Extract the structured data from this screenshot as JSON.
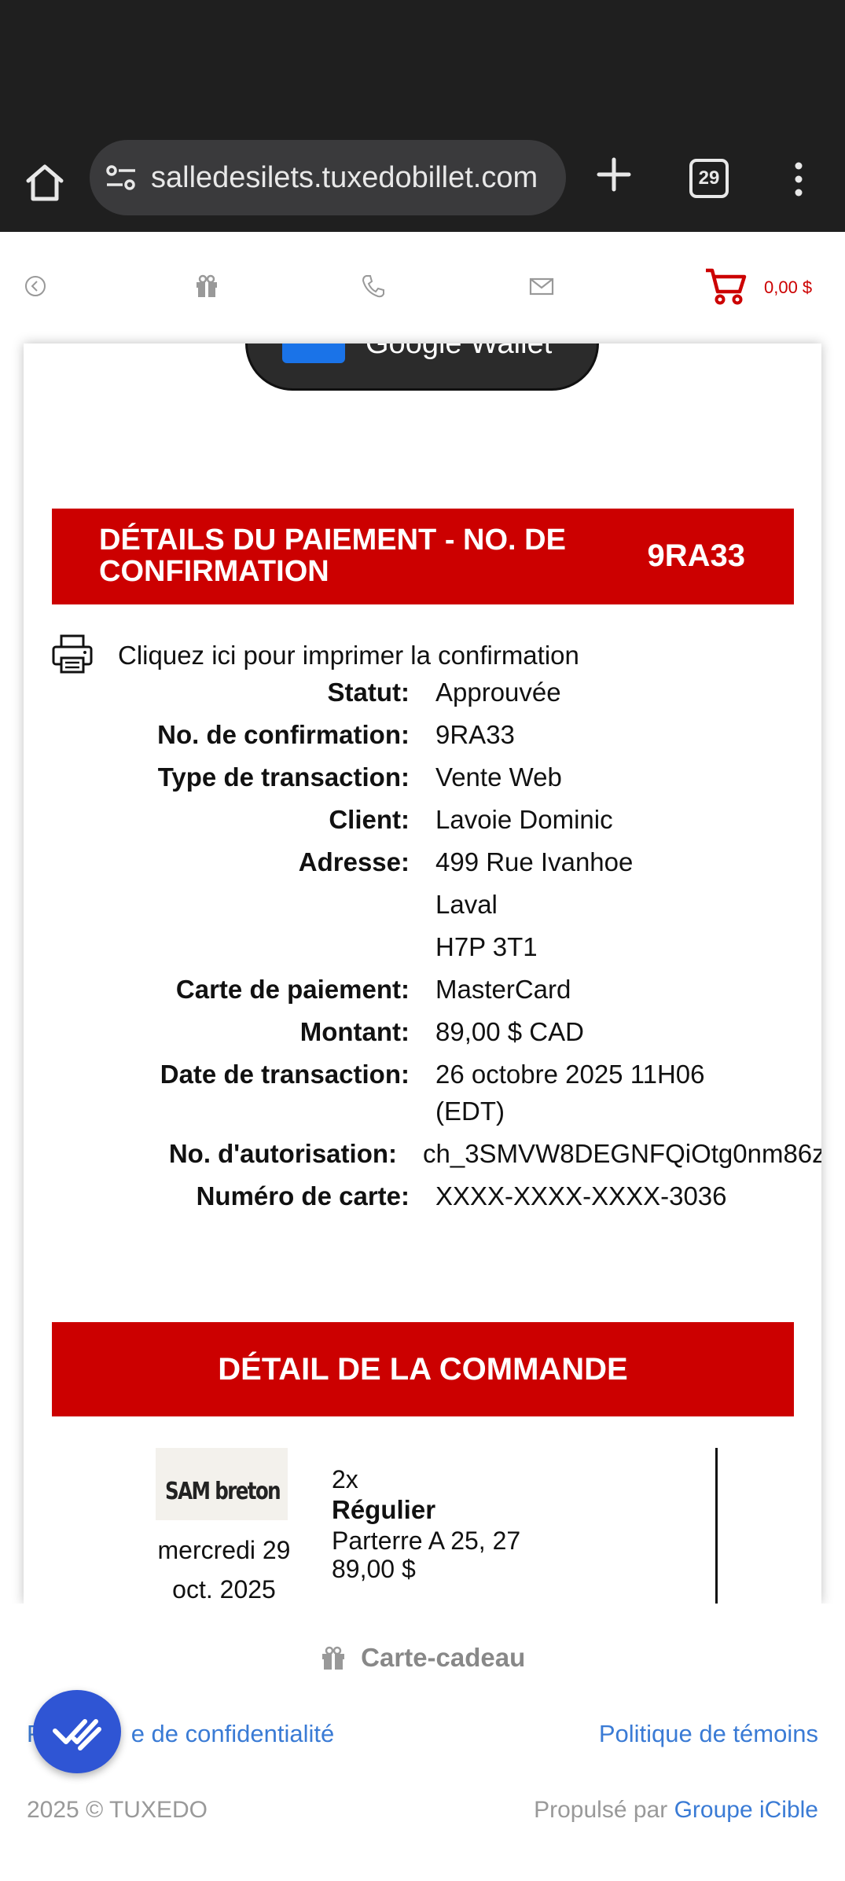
{
  "browser": {
    "url": "salledesilets.tuxedobillet.com",
    "tab_count": "29"
  },
  "nav": {
    "cart_total": "0,00 $",
    "icons": [
      "back-circle-icon",
      "gift-icon",
      "phone-icon",
      "mail-icon",
      "cart-icon"
    ]
  },
  "wallet": {
    "label": "Google Wallet"
  },
  "payment": {
    "title": "DÉTAILS DU PAIEMENT - NO. DE CONFIRMATION",
    "code": "9RA33",
    "print_link": "Cliquez ici pour imprimer la confirmation",
    "rows": [
      {
        "label": "Statut:",
        "value": "Approuvée"
      },
      {
        "label": "No. de confirmation:",
        "value": "9RA33"
      },
      {
        "label": "Type de transaction:",
        "value": "Vente Web"
      },
      {
        "label": "Client:",
        "value": "Lavoie Dominic"
      },
      {
        "label": "Adresse:",
        "value": "499 Rue Ivanhoe"
      },
      {
        "label": "",
        "value": "Laval"
      },
      {
        "label": "",
        "value": "H7P 3T1"
      },
      {
        "label": "Carte de paiement:",
        "value": "MasterCard"
      },
      {
        "label": "Montant:",
        "value": "89,00 $ CAD"
      },
      {
        "label": "Date de transaction:",
        "value": "26 octobre 2025 11H06"
      },
      {
        "label": "",
        "value": "(EDT)"
      },
      {
        "label": "No. d'autorisation:",
        "value": "ch_3SMVW8DEGNFQiOtg0nm86z"
      },
      {
        "label": "Numéro de carte:",
        "value": "XXXX-XXXX-XXXX-3036"
      }
    ]
  },
  "order": {
    "title": "DÉTAIL DE LA COMMANDE",
    "thumb_text": "SAM breton",
    "date_line1": "mercredi 29",
    "date_line2": "oct. 2025",
    "quantity": "2x",
    "type": "Régulier",
    "seats": "Parterre A 25, 27",
    "price": "89,00 $"
  },
  "footer": {
    "gift_card": "Carte-cadeau",
    "privacy_prefix": "P",
    "privacy_suffix": "e de confidentialité",
    "cookies": "Politique de témoins",
    "copyright": "2025 © TUXEDO",
    "powered_prefix": "Propulsé par ",
    "powered_link": "Groupe iCible"
  },
  "colors": {
    "accent": "#cc0000",
    "link": "#3a7bd5",
    "fab": "#2f55d4",
    "chrome": "#1f1f1f"
  }
}
